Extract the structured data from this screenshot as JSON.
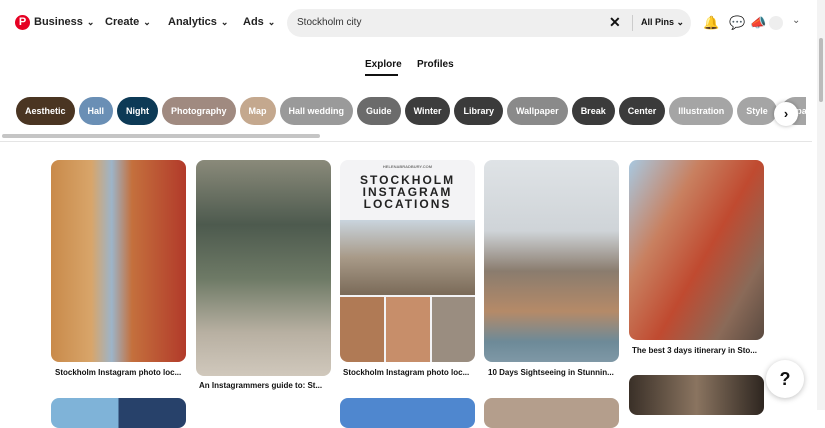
{
  "header": {
    "nav": [
      "Business",
      "Create",
      "Analytics",
      "Ads"
    ],
    "search_value": "Stockholm city",
    "scope": "All Pins"
  },
  "tabs": [
    "Explore",
    "Profiles"
  ],
  "pills": [
    {
      "label": "Aesthetic",
      "color": "#4a3522"
    },
    {
      "label": "Hall",
      "color": "#6a8fb5"
    },
    {
      "label": "Night",
      "color": "#0d3a56"
    },
    {
      "label": "Photography",
      "color": "#a08a80"
    },
    {
      "label": "Map",
      "color": "#c4a88e"
    },
    {
      "label": "Hall wedding",
      "color": "#9a9a9a"
    },
    {
      "label": "Guide",
      "color": "#6b6b6b"
    },
    {
      "label": "Winter",
      "color": "#3d3d3d"
    },
    {
      "label": "Library",
      "color": "#3b3b3b"
    },
    {
      "label": "Wallpaper",
      "color": "#8a8a8a"
    },
    {
      "label": "Break",
      "color": "#3b3b3b"
    },
    {
      "label": "Center",
      "color": "#3b3b3b"
    },
    {
      "label": "Illustration",
      "color": "#a5a5a5"
    },
    {
      "label": "Style",
      "color": "#a5a5a5"
    },
    {
      "label": "Apartment",
      "color": "#a5a5a5"
    }
  ],
  "pins": [
    {
      "title": "Stockholm Instagram photo loc..."
    },
    {
      "title": "An Instagrammers guide to: St..."
    },
    {
      "title": "Stockholm Instagram photo loc...",
      "site": "HELENABRADBURY.COM",
      "overlay": "STOCKHOLM INSTAGRAM LOCATIONS"
    },
    {
      "title": "10 Days Sightseeing in Stunnin..."
    },
    {
      "title": "The best 3 days itinerary in Sto..."
    }
  ],
  "help": "?"
}
